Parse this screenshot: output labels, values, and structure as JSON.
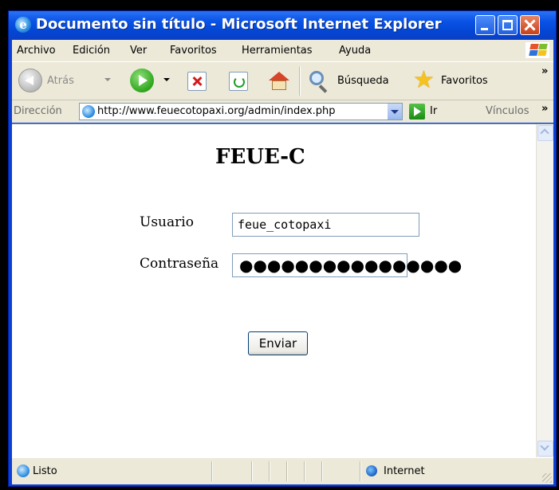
{
  "window": {
    "title": "Documento sin título - Microsoft Internet Explorer"
  },
  "menu": [
    "Archivo",
    "Edición",
    "Ver",
    "Favoritos",
    "Herramientas",
    "Ayuda"
  ],
  "toolbar": {
    "back_label": "Atrás",
    "search_label": "Búsqueda",
    "favorites_label": "Favoritos",
    "overflow": "»"
  },
  "address": {
    "label": "Dirección",
    "url": "http://www.feuecotopaxi.org/admin/index.php",
    "go_label": "Ir",
    "links_label": "Vínculos",
    "overflow": "»"
  },
  "page": {
    "title": "FEUE-C",
    "user_label": "Usuario",
    "user_value": "feue_cotopaxi",
    "password_label": "Contraseña",
    "password_masked": "●●●●●●●●●●●●●●●●",
    "submit_label": "Enviar"
  },
  "status": {
    "text": "Listo",
    "zone": "Internet"
  },
  "colors": {
    "titlebar": "#0a53e6",
    "chrome": "#ece9d8",
    "content": "#ffffff"
  }
}
